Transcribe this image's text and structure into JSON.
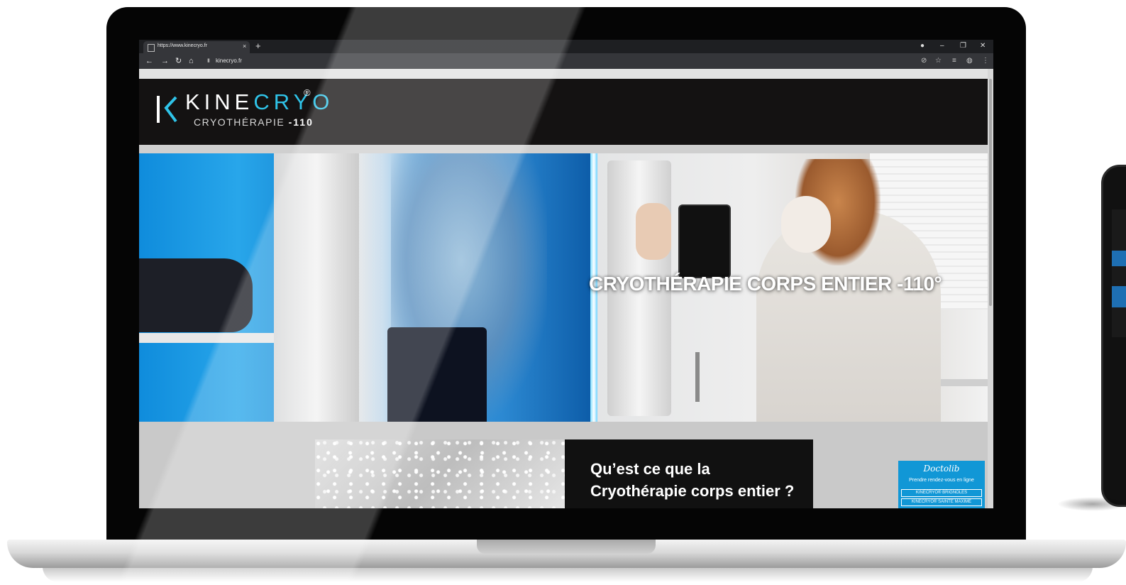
{
  "browser": {
    "tab_title": "https://www.kinecryo.fr",
    "tab_close": "×",
    "new_tab": "+",
    "address": "kinecryo.fr",
    "window_controls": [
      "●",
      "–",
      "❐",
      "✕"
    ],
    "toolbar_right": [
      "⊘",
      "☆",
      "≡",
      "◍",
      "⋮"
    ],
    "nav": {
      "back": "←",
      "forward": "→",
      "reload": "↻",
      "home": "⌂"
    }
  },
  "site": {
    "logo": {
      "kine": "KINE",
      "cryo": "CRYO",
      "registered": "®",
      "subtitle_text": "CRYOTHÉRAPIE ",
      "subtitle_bold": "-110",
      "accent_color": "#2fc3e8"
    },
    "hero": {
      "title": "CRYOTHÉRAPIE CORPS ENTIER -110°"
    },
    "section": {
      "title": "Qu’est ce que la Cryothérapie corps entier ?"
    },
    "doctolib": {
      "logo": "Doctolib",
      "cta": "Prendre rendez-vous en ligne",
      "links": [
        "KINECRYO® BRIGNOLES",
        "KINECRYO® SAINTE MAXIME"
      ],
      "color": "#1197d6"
    }
  }
}
